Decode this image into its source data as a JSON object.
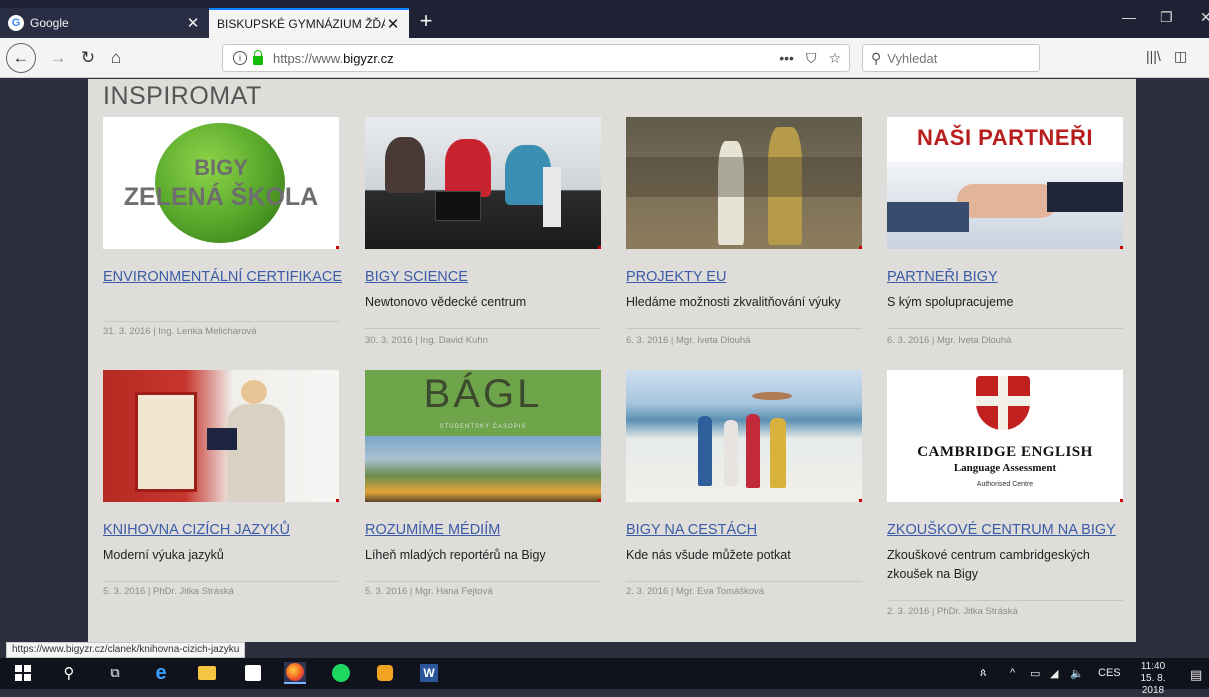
{
  "browser": {
    "tabs": [
      {
        "label": "Google",
        "active": false
      },
      {
        "label": "BISKUPSKÉ GYMNÁZIUM ŽĎÁR NA",
        "active": true
      }
    ],
    "url_prefix": "https://www.",
    "url_host": "bigyzr.cz",
    "search_placeholder": "Vyhledat",
    "status_link": "https://www.bigyzr.cz/clanek/knihovna-cizich-jazyku",
    "accent_color": "#0a84ff"
  },
  "section": {
    "title": "INSPIROMAT"
  },
  "cards": [
    {
      "title": "ENVIRONMENTÁLNÍ CERTIFIKACE",
      "subtitle": "",
      "meta": "31. 3. 2016 | Ing. Lenka Melicharová",
      "image_text": [
        "BIGY",
        "ZELENÁ ŠKOLA"
      ]
    },
    {
      "title": "BIGY SCIENCE",
      "subtitle": "Newtonovo vědecké centrum",
      "meta": "30. 3. 2016 | Ing. David Kuhn"
    },
    {
      "title": "PROJEKTY EU",
      "subtitle": "Hledáme možnosti zkvalitňování výuky",
      "meta": "6. 3. 2016 | Mgr. Iveta Dlouhá"
    },
    {
      "title": "PARTNEŘI BIGY",
      "subtitle": "S kým spolupracujeme",
      "meta": "6. 3. 2016 | Mgr. Iveta Dlouhá",
      "image_text": "NAŠI PARTNEŘI"
    },
    {
      "title": "KNIHOVNA CIZÍCH JAZYKŮ",
      "subtitle": "Moderní výuka jazyků",
      "meta": "5. 3. 2016 | PhDr. Jitka Stráská"
    },
    {
      "title": "ROZUMÍME MÉDIÍM",
      "subtitle": "Líheň mladých reportérů na Bigy",
      "meta": "5. 3. 2016 | Mgr. Hana Fejtová",
      "image_text": [
        "BÁGL",
        "STUDENTSKÝ ČASOPIS"
      ]
    },
    {
      "title": "BIGY NA CESTÁCH",
      "subtitle": "Kde nás všude můžete potkat",
      "meta": "2. 3. 2016 | Mgr. Eva Tomášková"
    },
    {
      "title": "ZKOUŠKOVÉ CENTRUM NA BIGY",
      "subtitle": "Zkouškové centrum cambridgeských zkoušek na Bigy",
      "meta": "2. 3. 2016 | PhDr. Jitka Stráská",
      "image_text": [
        "CAMBRIDGE ENGLISH",
        "Language Assessment",
        "Authorised Centre"
      ]
    }
  ],
  "taskbar": {
    "language": "CES",
    "time": "11:40",
    "date": "15. 8. 2018"
  }
}
